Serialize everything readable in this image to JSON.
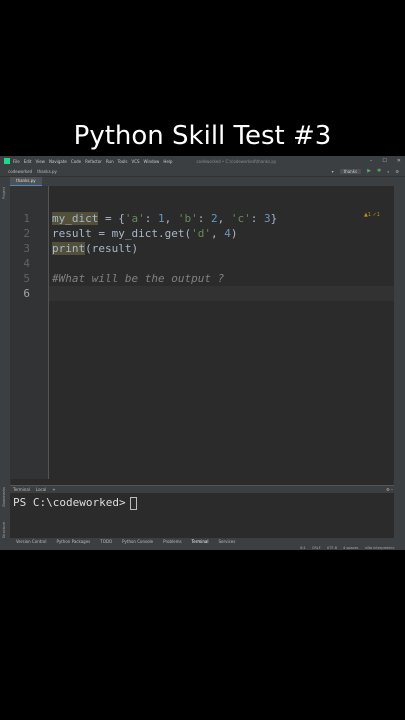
{
  "headline": "Python Skill Test #3",
  "window": {
    "menu": [
      "File",
      "Edit",
      "View",
      "Navigate",
      "Code",
      "Refactor",
      "Run",
      "Tools",
      "VCS",
      "Window",
      "Help"
    ],
    "path": "codeworked • C:\\codeworked\\thanks.py"
  },
  "nav": {
    "project": "codeworked",
    "file": "thanks.py",
    "run_config": "thanks"
  },
  "tab": {
    "label": "thanks.py"
  },
  "editor": {
    "line_numbers": [
      "1",
      "2",
      "3",
      "4",
      "5",
      "6"
    ],
    "markers": "▲1 ✓1",
    "lines": {
      "l1": {
        "var": "my_dict",
        "eq": " = {",
        "k1": "'a'",
        "c1": ": ",
        "v1": "1",
        "s1": ", ",
        "k2": "'b'",
        "c2": ": ",
        "v2": "2",
        "s2": ", ",
        "k3": "'c'",
        "c3": ": ",
        "v3": "3",
        "end": "}"
      },
      "l2": {
        "pre": "result = my_dict.get(",
        "arg": "'d'",
        "comma": ", ",
        "num": "4",
        "end": ")"
      },
      "l3": {
        "fn": "print",
        "rest": "(result)"
      },
      "l5": {
        "comment": "#What will be the output ?"
      }
    }
  },
  "terminal": {
    "tab_label": "Terminal",
    "sub_tab": "Local",
    "prompt": "PS C:\\codeworked>"
  },
  "toolbar": [
    "Version Control",
    "Python Packages",
    "TODO",
    "Python Console",
    "Problems",
    "Terminal",
    "Services"
  ],
  "status": [
    "6:1",
    "CRLF",
    "UTF-8",
    "4 spaces",
    "<No interpreter>"
  ],
  "side_labels": {
    "project": "Project",
    "structure": "Structure",
    "bookmarks": "Bookmarks"
  }
}
